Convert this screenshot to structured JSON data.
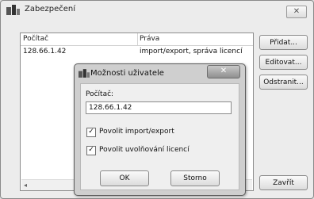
{
  "window": {
    "title": "Zabezpečení",
    "close_glyph": "✕"
  },
  "list": {
    "columns": [
      "Počítač",
      "Práva"
    ],
    "rows": [
      {
        "computer": "128.66.1.42",
        "rights": "import/export, správa licencí"
      }
    ],
    "scroll_left_glyph": "◂"
  },
  "buttons": {
    "add": "Přidat...",
    "edit": "Editovat...",
    "remove": "Odstranit...",
    "close": "Zavřít"
  },
  "dialog": {
    "title": "Možnosti uživatele",
    "close_glyph": "✕",
    "computer_label": "Počítač:",
    "computer_value": "128.66.1.42",
    "checkbox_import_export": {
      "label": "Povolit import/export",
      "checked": true
    },
    "checkbox_licence": {
      "label": "Povolit uvolňování licencí",
      "checked": true
    },
    "ok": "OK",
    "cancel": "Storno",
    "check_glyph": "✓"
  },
  "icons": {
    "app": "computers-icon",
    "dialog": "computers-icon"
  }
}
